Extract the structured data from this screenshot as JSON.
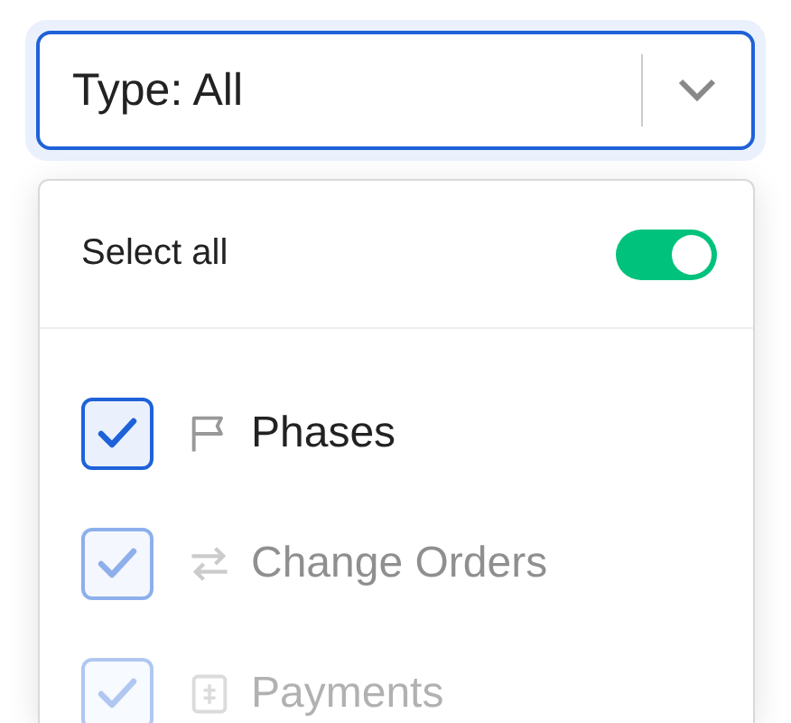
{
  "select": {
    "value": "Type: All",
    "open": true
  },
  "select_all": {
    "label": "Select all",
    "on": true
  },
  "options": [
    {
      "label": "Phases",
      "checked": true
    },
    {
      "label": "Change Orders",
      "checked": true
    },
    {
      "label": "Payments",
      "checked": true
    }
  ]
}
